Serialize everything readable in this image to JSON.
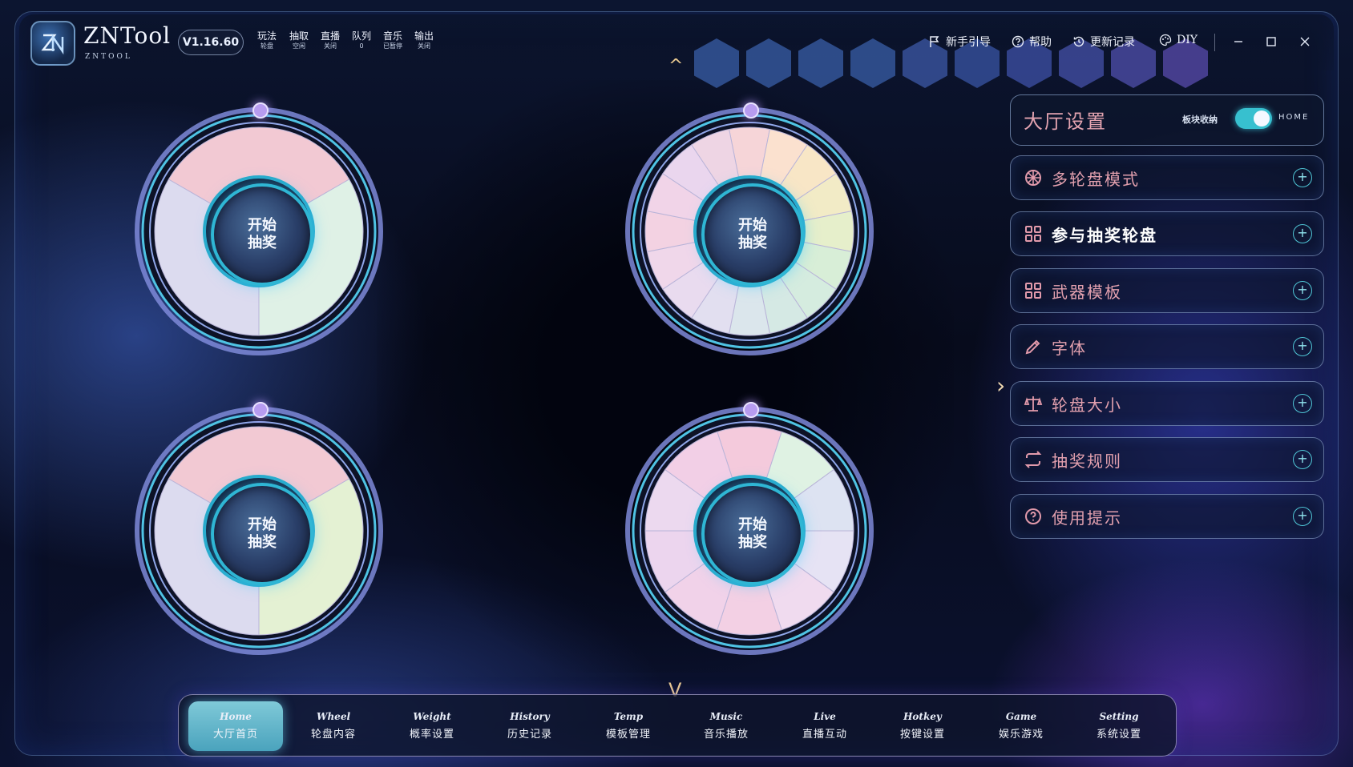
{
  "app": {
    "name": "ZNTool",
    "sub": "ZNTOOL",
    "version": "V1.16.60",
    "logo_text": "ZN"
  },
  "status": [
    {
      "key": "玩法",
      "value": "轮盘"
    },
    {
      "key": "抽取",
      "value": "空闲"
    },
    {
      "key": "直播",
      "value": "关闭"
    },
    {
      "key": "队列",
      "value": "0"
    },
    {
      "key": "音乐",
      "value": "已暂停"
    },
    {
      "key": "输出",
      "value": "关闭"
    }
  ],
  "hex_colors": [
    "#3a5fa8",
    "#3a5fa8",
    "#3a5fa8",
    "#3a5fa8",
    "#3d5aa8",
    "#3a56a6",
    "#3f52a8",
    "#4652aa",
    "#5050ae",
    "#5a4cae"
  ],
  "toolbar": {
    "guide": "新手引导",
    "help": "帮助",
    "changelog": "更新记录",
    "diy": "DIY"
  },
  "wheels": [
    {
      "start_line1": "开始",
      "start_line2": "抽奖",
      "segments": [
        "",
        "",
        ""
      ],
      "colors": [
        "#f2c9d3",
        "#dff1e6",
        "#dcdbef"
      ]
    },
    {
      "start_line1": "开始",
      "start_line2": "抽奖",
      "segments": [
        "",
        "",
        "",
        "",
        "",
        "",
        "",
        "",
        "",
        "",
        "",
        "",
        "",
        "",
        "",
        ""
      ],
      "colors": [
        "#f6d5d8",
        "#fbe1cf",
        "#f8e6c6",
        "#f2ebc6",
        "#e6efcb",
        "#d8eed7",
        "#d5ecdf",
        "#d5e9e4",
        "#dbe6ec",
        "#e2dff0",
        "#e9dbef",
        "#f0d7ea",
        "#f3d2e2",
        "#f1d4e8",
        "#ead6ee",
        "#eed5e4"
      ]
    },
    {
      "start_line1": "开始",
      "start_line2": "抽奖",
      "segments": [
        "",
        "",
        ""
      ],
      "colors": [
        "#f2c9d3",
        "#e4f1d3",
        "#dcdbef"
      ]
    },
    {
      "start_line1": "开始",
      "start_line2": "抽奖",
      "segments": [
        "",
        "",
        "",
        "",
        "",
        "",
        "",
        "",
        "",
        ""
      ],
      "colors": [
        "#f4cadc",
        "#dff2e3",
        "#dde3f2",
        "#e6e3f4",
        "#f0dbef",
        "#f3d0e4",
        "#f1d2e9",
        "#ecd5ee",
        "#ecd9ef",
        "#f2cfe6"
      ]
    }
  ],
  "panel": {
    "title": "大厅设置",
    "collapse_label": "板块收纳",
    "home_label": "HOME",
    "sections": [
      {
        "label": "多轮盘模式",
        "icon": "wheel-icon"
      },
      {
        "label": "参与抽奖轮盘",
        "icon": "grid-icon"
      },
      {
        "label": "武器模板",
        "icon": "grid-icon"
      },
      {
        "label": "字体",
        "icon": "pen-icon"
      },
      {
        "label": "轮盘大小",
        "icon": "scale-icon"
      },
      {
        "label": "抽奖规则",
        "icon": "repeat-icon"
      },
      {
        "label": "使用提示",
        "icon": "help-icon"
      }
    ]
  },
  "nav": [
    {
      "en": "Home",
      "zh": "大厅首页"
    },
    {
      "en": "Wheel",
      "zh": "轮盘内容"
    },
    {
      "en": "Weight",
      "zh": "概率设置"
    },
    {
      "en": "History",
      "zh": "历史记录"
    },
    {
      "en": "Temp",
      "zh": "模板管理"
    },
    {
      "en": "Music",
      "zh": "音乐播放"
    },
    {
      "en": "Live",
      "zh": "直播互动"
    },
    {
      "en": "Hotkey",
      "zh": "按键设置"
    },
    {
      "en": "Game",
      "zh": "娱乐游戏"
    },
    {
      "en": "Setting",
      "zh": "系统设置"
    }
  ]
}
